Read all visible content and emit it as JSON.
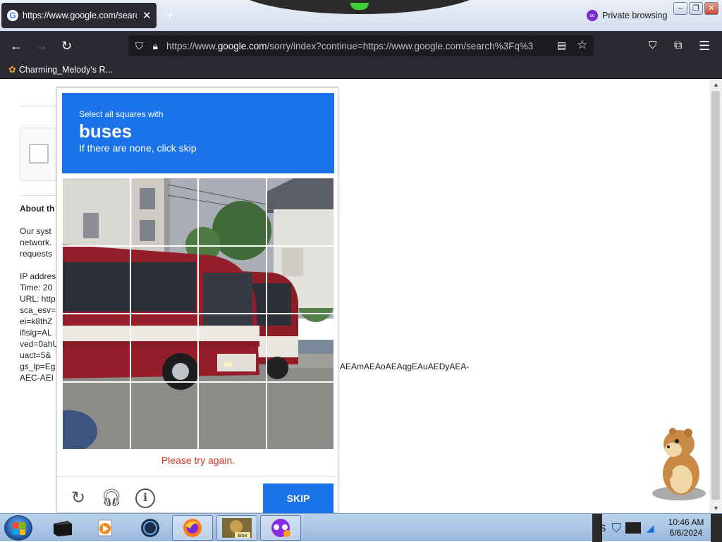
{
  "browser": {
    "tab": {
      "title": "https://www.google.com/search",
      "close": "✕",
      "favicon": "G"
    },
    "new_tab": "+",
    "private_label": "Private browsing",
    "url": {
      "prefix": "https://www.",
      "host": "google.com",
      "rest": "/sorry/index?continue=https://www.google.com/search%3Fq%3"
    },
    "bookmark": "Charming_Melody's R..."
  },
  "background_page": {
    "about_heading": "About th",
    "lines_a": [
      "Our syst",
      "network.",
      "requests"
    ],
    "lines_b": [
      "IP addres",
      "Time: 20",
      "URL: http",
      "sca_esv=",
      "ei=k8thZ",
      "iflsig=AL",
      "ved=0ahU",
      "uact=5&",
      "gs_lp=Eg",
      "AEC-AEI"
    ],
    "tail_text": "AEAmAEAoAEAqgEAuAEDyAEA-"
  },
  "captcha": {
    "instruction": "Select all squares with",
    "target": "buses",
    "hint": "If there are none, click skip",
    "error": "Please try again.",
    "skip_label": "SKIP",
    "icons": [
      "reload-icon",
      "headphones-icon",
      "info-icon"
    ],
    "tiles": 16,
    "colors": {
      "header": "#1a73e8",
      "error": "#d93025"
    }
  },
  "taskbar": {
    "clock_time": "10:46 AM",
    "clock_date": "6/6/2024",
    "tray_letter": "S",
    "apps": [
      "black-box-app-icon",
      "media-player-icon",
      "globe-app-icon",
      "firefox-icon",
      "box-game-icon",
      "private-browsing-icon"
    ],
    "box_label": "Box"
  }
}
